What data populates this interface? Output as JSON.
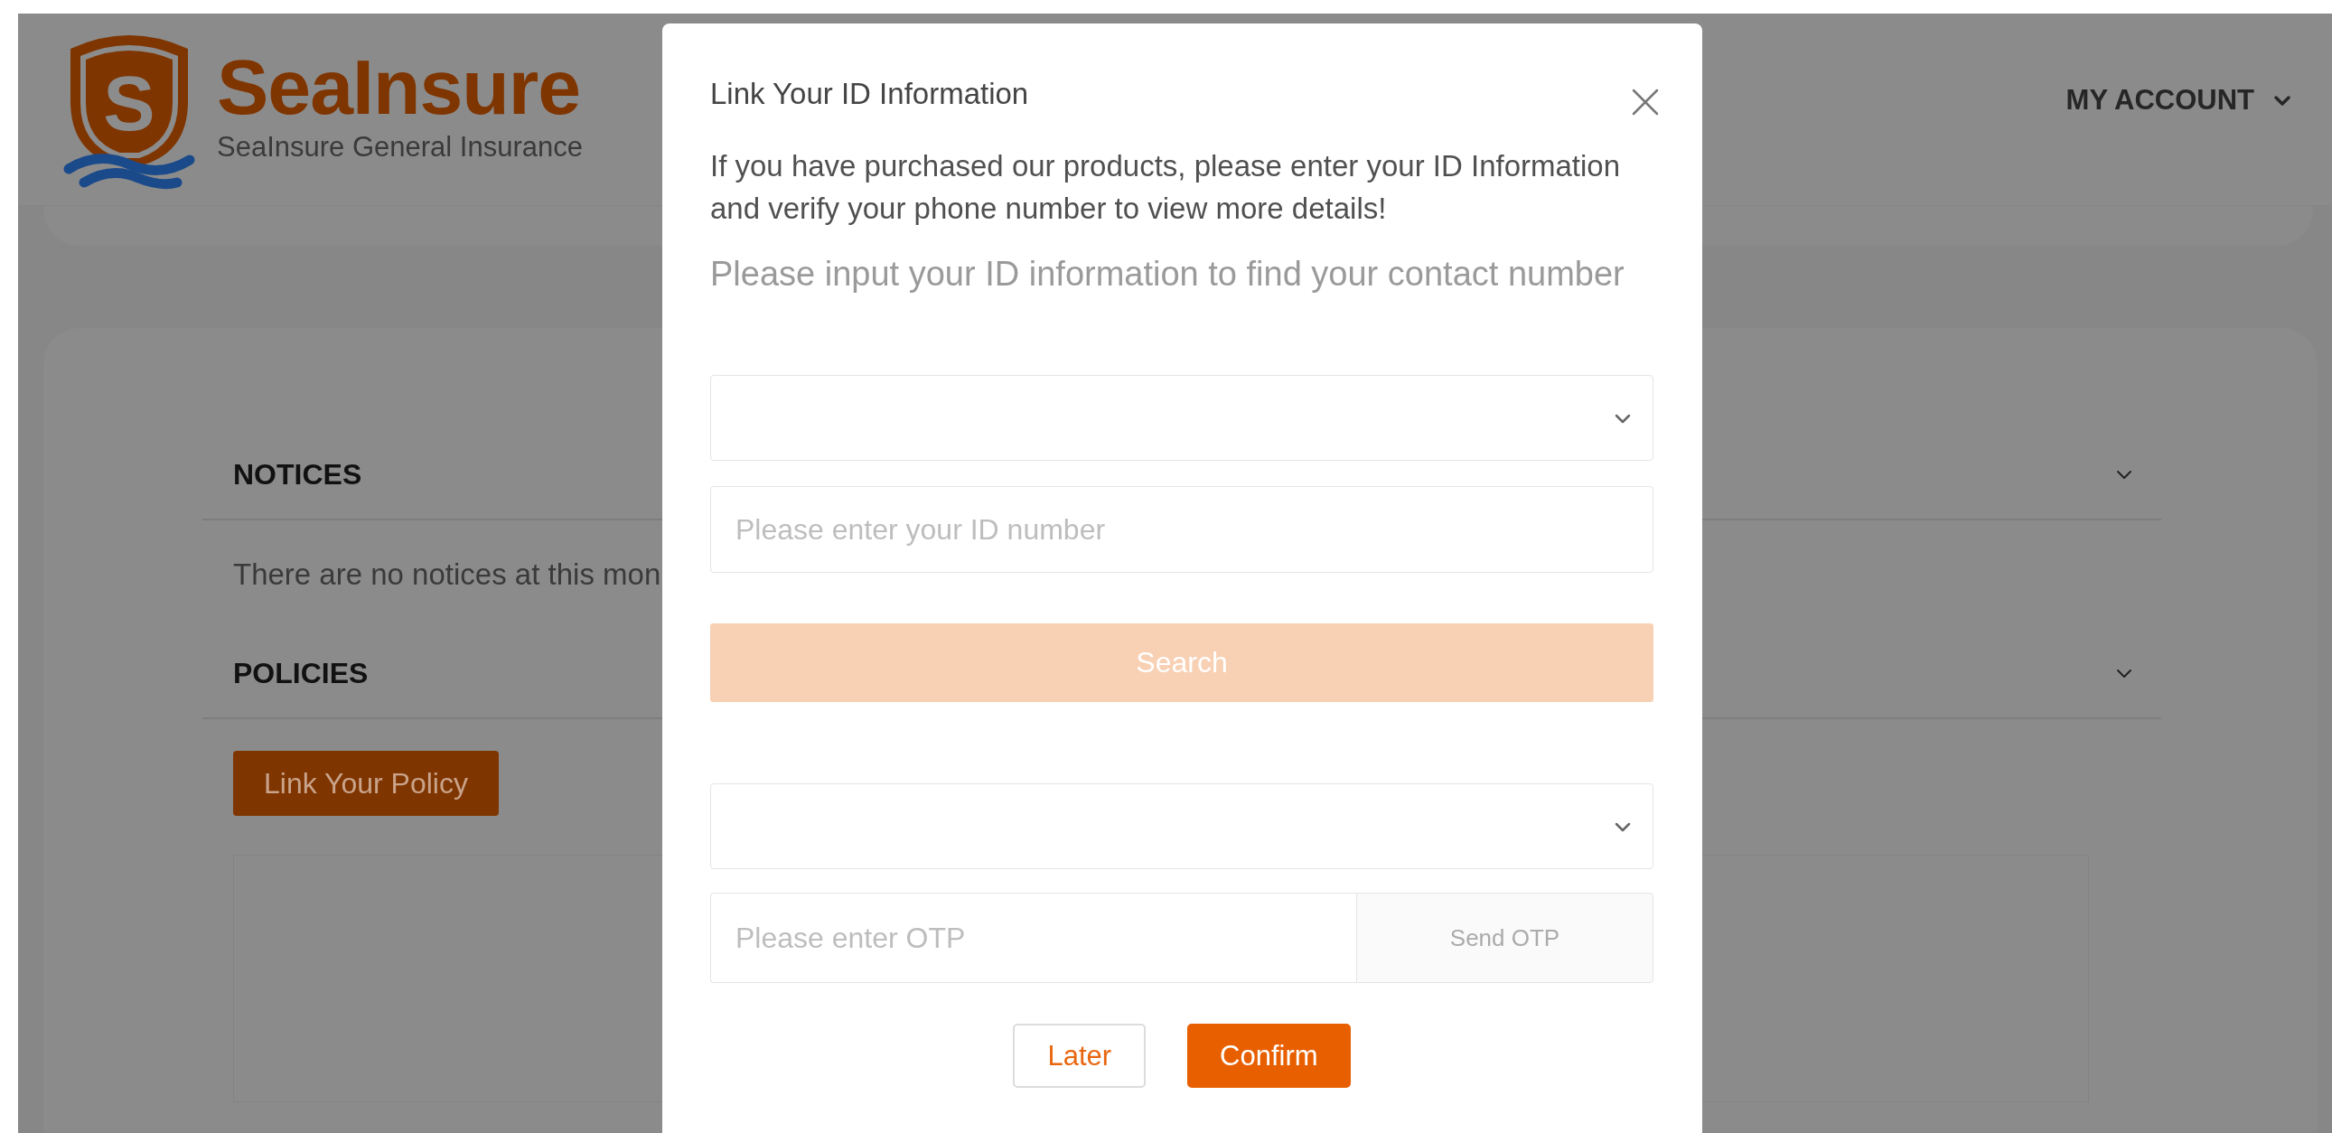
{
  "header": {
    "logo": {
      "badge_letter": "S",
      "wordmark": "SeaInsure",
      "tagline": "SeaInsure General Insurance"
    },
    "account_menu": {
      "label": "MY ACCOUNT"
    }
  },
  "sections": [
    {
      "title": "NOTICES",
      "kind": "message",
      "message": "There are no notices at this mon"
    },
    {
      "title": "POLICIES",
      "kind": "policies",
      "button": "Link Your Policy"
    }
  ],
  "modal": {
    "title": "Link Your ID Information",
    "intro": "If you have purchased our products, please enter your ID Information and verify your phone number to view more details!",
    "hint": "Please input your ID information to find your contact number",
    "fields": [
      {
        "kind": "select"
      },
      {
        "kind": "input",
        "placeholder": "Please enter your ID number"
      },
      {
        "kind": "button",
        "label": "Search",
        "disabled": true
      },
      {
        "kind": "select"
      },
      {
        "kind": "otp",
        "placeholder": "Please enter OTP",
        "button": "Send OTP",
        "disabled": true
      }
    ],
    "actions": [
      {
        "label": "Later",
        "primary": false
      },
      {
        "label": "Confirm",
        "primary": true
      }
    ]
  }
}
